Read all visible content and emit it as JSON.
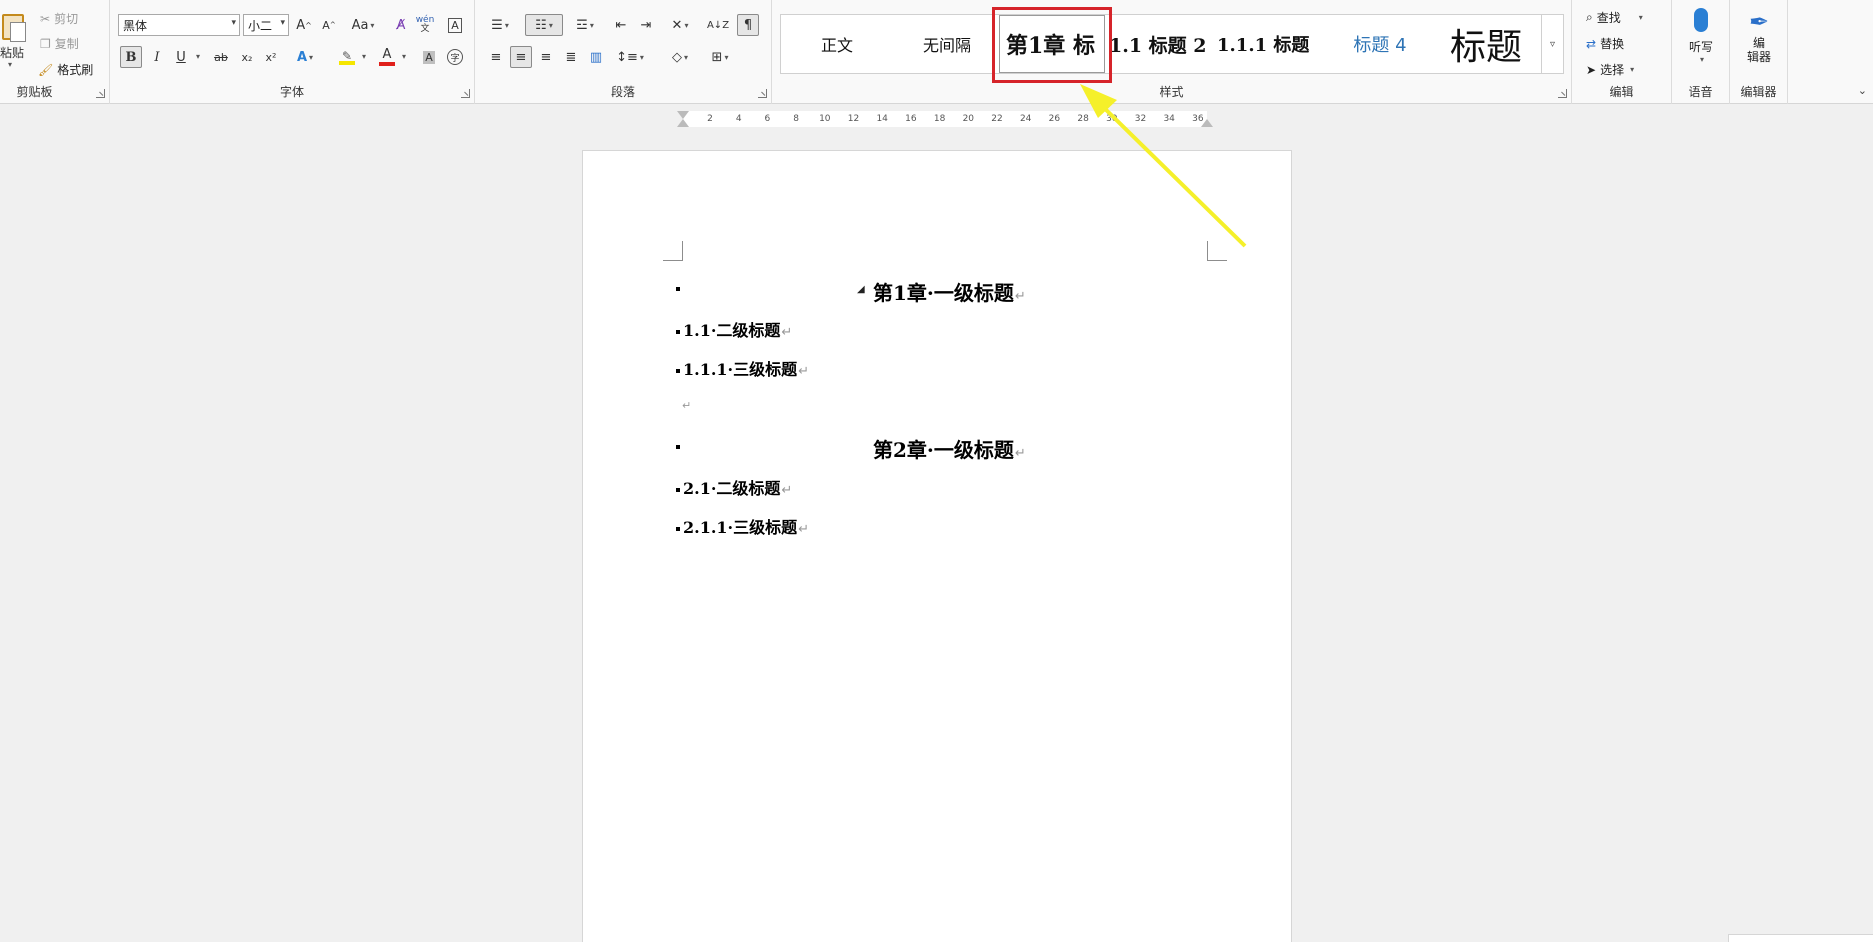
{
  "clipboard": {
    "paste_label": "粘贴",
    "cut_label": "剪切",
    "copy_label": "复制",
    "format_painter_label": "格式刷",
    "group_label": "剪贴板"
  },
  "font": {
    "font_name": "黑体",
    "font_size": "小二",
    "grow_label": "A^",
    "shrink_label": "A^",
    "case_label": "Aa",
    "phonetic_label": "wén",
    "bold_label": "B",
    "italic_label": "I",
    "underline_label": "U",
    "strike_label": "ab",
    "subscript_label": "x₂",
    "superscript_label": "x²",
    "group_label": "字体",
    "text_color": "#e0201b",
    "highlight_color": "#f5e600"
  },
  "paragraph": {
    "group_label": "段落"
  },
  "styles": {
    "group_label": "样式",
    "items": [
      {
        "label": "正文"
      },
      {
        "label": "无间隔"
      },
      {
        "label": "第1章  标"
      },
      {
        "label": "1.1  标题 2"
      },
      {
        "label": "1.1.1  标题"
      },
      {
        "label": "标题 4"
      },
      {
        "label": "标题"
      }
    ]
  },
  "editing": {
    "find_label": "查找",
    "replace_label": "替换",
    "select_label": "选择",
    "group_label": "编辑"
  },
  "voice": {
    "dictate_label": "听写",
    "group_label": "语音"
  },
  "editor": {
    "editor_label_1": "编",
    "editor_label_2": "辑器",
    "group_label": "编辑器"
  },
  "ruler": {
    "ticks": [
      "2",
      "4",
      "6",
      "8",
      "10",
      "12",
      "14",
      "16",
      "18",
      "20",
      "22",
      "24",
      "26",
      "28",
      "30",
      "32",
      "34",
      "36"
    ]
  },
  "document": {
    "paragraphs": [
      {
        "text": "第1章·一级标题"
      },
      {
        "text": "1.1·二级标题"
      },
      {
        "text": "1.1.1·三级标题"
      },
      {
        "text": ""
      },
      {
        "text": "第2章·一级标题"
      },
      {
        "text": "2.1·二级标题"
      },
      {
        "text": "2.1.1·三级标题"
      }
    ],
    "paragraph_mark": "↵"
  },
  "colors": {
    "highlight_box": "#d6242a",
    "arrow": "#f5f02a"
  }
}
